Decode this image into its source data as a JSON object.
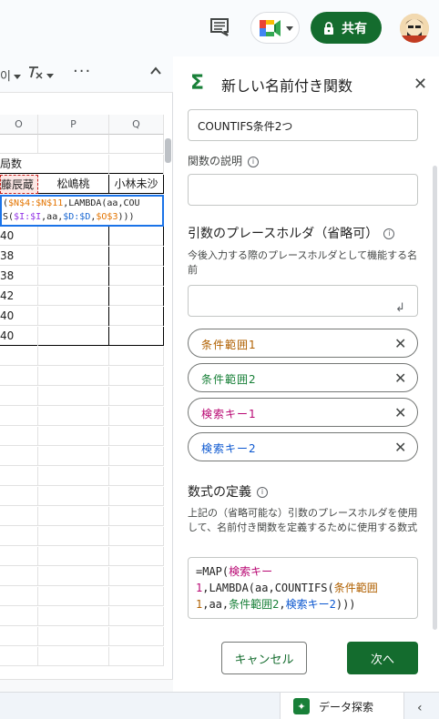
{
  "topbar": {
    "share_label": "共有"
  },
  "toolbar": {
    "item1": "이",
    "more": "···"
  },
  "sheet": {
    "columns": [
      "O",
      "P",
      "Q"
    ],
    "rows": [
      {
        "o": "",
        "p": "",
        "q": ""
      },
      {
        "o": "局数",
        "p": "",
        "q": ""
      },
      {
        "o": "藤辰蔵",
        "p": "松嶋桃",
        "q": "小林未沙"
      },
      {
        "o": "",
        "p": "",
        "q": ""
      },
      {
        "o": "",
        "p": "",
        "q": ""
      },
      {
        "o": "40",
        "p": "",
        "q": ""
      },
      {
        "o": "38",
        "p": "",
        "q": ""
      },
      {
        "o": "38",
        "p": "",
        "q": ""
      },
      {
        "o": "42",
        "p": "",
        "q": ""
      },
      {
        "o": "40",
        "p": "",
        "q": ""
      },
      {
        "o": "40",
        "p": "",
        "q": ""
      }
    ],
    "formula_line1_a": "(",
    "formula_line1_b": "$N$4:$N$11",
    "formula_line1_c": ",LAMBDA(aa,COU",
    "formula_line2_a": "S(",
    "formula_line2_b": "$I:$I",
    "formula_line2_c": ",aa,",
    "formula_line2_d": "$D:$D",
    "formula_line2_e": ",",
    "formula_line2_f": "$O$3",
    "formula_line2_g": ")))"
  },
  "panel": {
    "title": "新しい名前付き関数",
    "function_name_value": "COUNTIFS条件2つ",
    "description_label": "関数の説明",
    "description_value": "",
    "placeholders_title": "引数のプレースホルダ（省略可）",
    "placeholders_desc": "今後入力する際のプレースホルダとして機能する名前",
    "placeholder_input_value": "",
    "chips": [
      {
        "label": "条件範囲1",
        "color": "#b06000"
      },
      {
        "label": "条件範囲2",
        "color": "#188038"
      },
      {
        "label": "検索キー1",
        "color": "#b80672"
      },
      {
        "label": "検索キー2",
        "color": "#0b57d0"
      }
    ],
    "definition_title": "数式の定義",
    "definition_desc": "上記の（省略可能な）引数のプレースホルダを使用して、名前付き関数を定義するために使用する数式",
    "formula": {
      "p1": "=MAP(",
      "p2": "検索キー1",
      "p3": ",LAMBDA(aa,COUNTIFS(",
      "p4": "条件範囲1",
      "p5": ",aa,",
      "p6": "条件範囲2",
      "p7": ",",
      "p8": "検索キー2",
      "p9": ")))"
    },
    "cancel_label": "キャンセル",
    "next_label": "次へ"
  },
  "bottom": {
    "explore_label": "データ探索"
  }
}
